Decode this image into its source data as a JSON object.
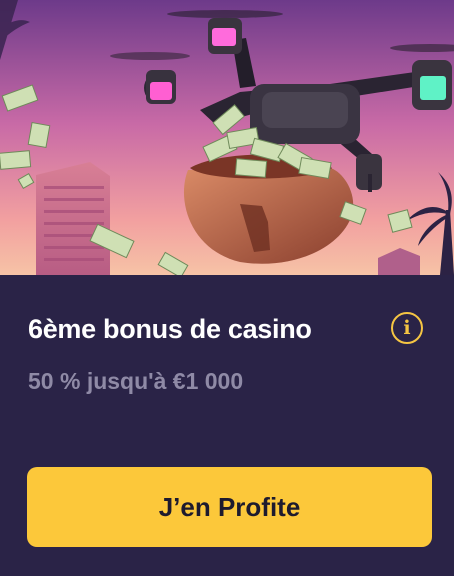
{
  "offer": {
    "title": "6ème bonus de casino",
    "subtitle": "50 % jusqu'à €1 000",
    "info_icon_glyph": "i",
    "cta_label": "J’en Profite"
  },
  "hero": {
    "image": "drone-carrying-money-bag-icon"
  },
  "colors": {
    "card_background": "#2a2347",
    "accent": "#fcc83a",
    "title_text": "#ffffff",
    "subtitle_text": "#8f8aa6",
    "cta_text": "#1e1b2e"
  }
}
